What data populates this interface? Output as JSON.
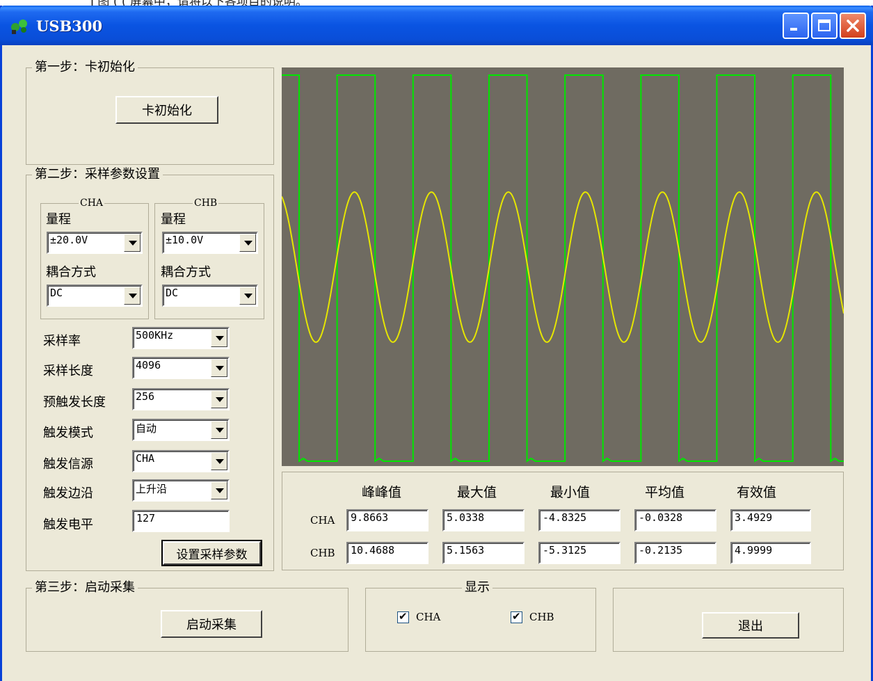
{
  "background_caption": "Ⅰ 图 (         (    屏幕中，请将以下各项目的说明。",
  "window": {
    "title": "USB300"
  },
  "step1": {
    "legend": "第一步：卡初始化",
    "init_button": "卡初始化"
  },
  "step2": {
    "legend": "第二步：采样参数设置",
    "cha": {
      "legend": "CHA",
      "range_label": "量程",
      "range_value": "±20.0V",
      "coupling_label": "耦合方式",
      "coupling_value": "DC"
    },
    "chb": {
      "legend": "CHB",
      "range_label": "量程",
      "range_value": "±10.0V",
      "coupling_label": "耦合方式",
      "coupling_value": "DC"
    },
    "sample_rate": {
      "label": "采样率",
      "value": "500KHz"
    },
    "sample_length": {
      "label": "采样长度",
      "value": "4096"
    },
    "pretrigger_length": {
      "label": "预触发长度",
      "value": "256"
    },
    "trigger_mode": {
      "label": "触发模式",
      "value": "自动"
    },
    "trigger_source": {
      "label": "触发信源",
      "value": "CHA"
    },
    "trigger_edge": {
      "label": "触发边沿",
      "value": "上升沿"
    },
    "trigger_level": {
      "label": "触发电平",
      "value": "127"
    },
    "set_button": "设置采样参数"
  },
  "measurements": {
    "columns": [
      "峰峰值",
      "最大值",
      "最小值",
      "平均值",
      "有效值"
    ],
    "rows": [
      {
        "channel": "CHA",
        "values": [
          "9.8663",
          "5.0338",
          "-4.8325",
          "-0.0328",
          "3.4929"
        ]
      },
      {
        "channel": "CHB",
        "values": [
          "10.4688",
          "5.1563",
          "-5.3125",
          "-0.2135",
          "4.9999"
        ]
      }
    ]
  },
  "step3": {
    "legend": "第三步：启动采集",
    "start_button": "启动采集"
  },
  "display": {
    "legend": "显示",
    "cha": {
      "label": "CHA",
      "checked": true
    },
    "chb": {
      "label": "CHB",
      "checked": true
    }
  },
  "exit_button": "退出",
  "scope": {
    "background_color": "#6f6b61",
    "cha_color": "#e6e600",
    "chb_color": "#00e600",
    "cha_sine_cycles": 7.3,
    "chb_square_cycles": 7.4
  }
}
